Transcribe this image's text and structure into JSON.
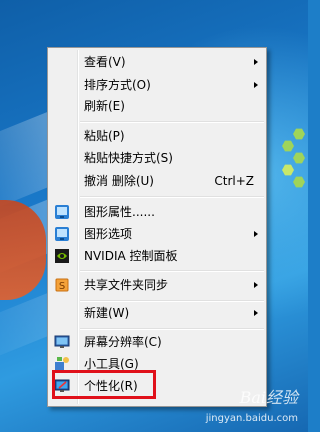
{
  "menu": {
    "items": [
      {
        "label": "查看(V)",
        "submenu": true
      },
      {
        "label": "排序方式(O)",
        "submenu": true
      },
      {
        "label": "刷新(E)"
      },
      {
        "label": "粘贴(P)"
      },
      {
        "label": "粘贴快捷方式(S)"
      },
      {
        "label": "撤消 删除(U)",
        "shortcut": "Ctrl+Z"
      },
      {
        "label": "图形属性......",
        "icon": "intel-graphics-icon"
      },
      {
        "label": "图形选项",
        "icon": "intel-graphics-icon",
        "submenu": true
      },
      {
        "label": "NVIDIA 控制面板",
        "icon": "nvidia-icon"
      },
      {
        "label": "共享文件夹同步",
        "icon": "sync-folder-icon",
        "submenu": true
      },
      {
        "label": "新建(W)",
        "submenu": true
      },
      {
        "label": "屏幕分辨率(C)",
        "icon": "monitor-icon"
      },
      {
        "label": "小工具(G)",
        "icon": "gadgets-icon"
      },
      {
        "label": "个性化(R)",
        "icon": "personalize-icon"
      }
    ]
  },
  "highlight_target": "个性化(R)",
  "watermark": {
    "brand": "Bai经验",
    "url": "jingyan.baidu.com"
  },
  "colors": {
    "highlight": "#e0101a",
    "menu_bg": "#f0f0f0"
  }
}
